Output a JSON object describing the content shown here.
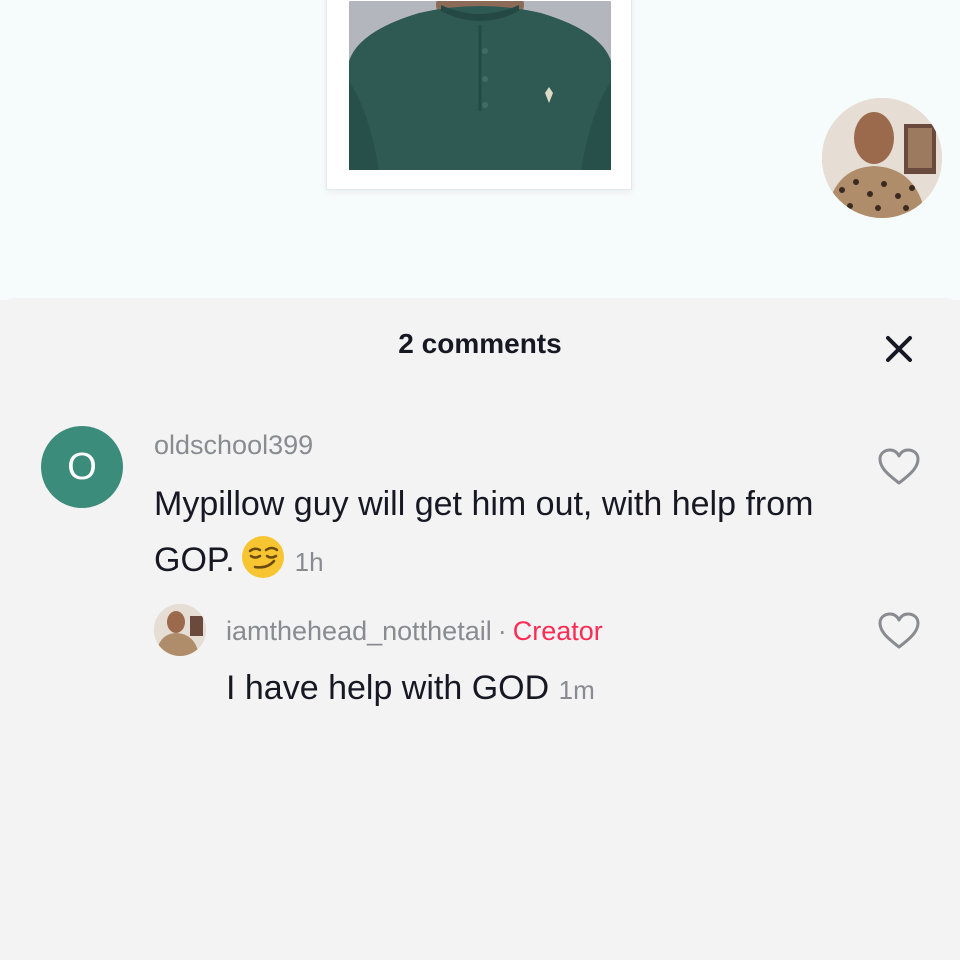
{
  "header": {
    "comments_count_label": "2 comments"
  },
  "comments": [
    {
      "avatar_letter": "O",
      "avatar_color": "#3c8c7c",
      "username": "oldschool399",
      "text": "Mypillow guy will get him out, with help from GOP.",
      "emoji": "smirking-face",
      "time": "1h",
      "liked": false
    }
  ],
  "reply": {
    "username": "iamthehead_notthetail",
    "separator": "·",
    "badge": "Creator",
    "text": "I have help with GOD",
    "time": "1m",
    "liked": false
  },
  "colors": {
    "accent_creator": "#fe2c55",
    "text_primary": "#161823",
    "text_secondary": "#8a8b91",
    "panel_bg": "#f3f3f3"
  },
  "icons": {
    "close": "close-icon",
    "like": "heart-outline-icon"
  }
}
